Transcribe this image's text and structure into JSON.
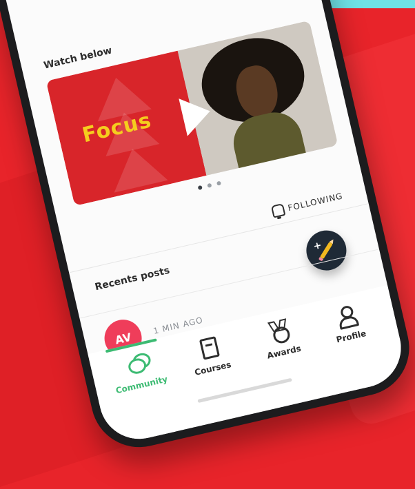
{
  "feed": {
    "section_title": "Watch below",
    "video": {
      "title": "Focus",
      "carousel_current": 1,
      "carousel_total": 3
    },
    "following_label": "FOLLOWING",
    "recents_title": "Recents posts",
    "post": {
      "initials": "AV",
      "time": "1 MIN AGO"
    }
  },
  "tabbar": {
    "active": "community",
    "items": [
      {
        "label": "Community",
        "icon": "chat-bubbles-icon"
      },
      {
        "label": "Courses",
        "icon": "book-icon"
      },
      {
        "label": "Awards",
        "icon": "medal-icon"
      },
      {
        "label": "Profile",
        "icon": "user-icon"
      }
    ]
  },
  "colors": {
    "background": "#e8242a",
    "accent_top": "#6fe3e6",
    "brand_red": "#d8252a",
    "focus_yellow": "#f5cd1e",
    "active_green": "#3dbb73",
    "fab_navy": "#1f2a36",
    "avatar_pink": "#ef3d5a"
  }
}
